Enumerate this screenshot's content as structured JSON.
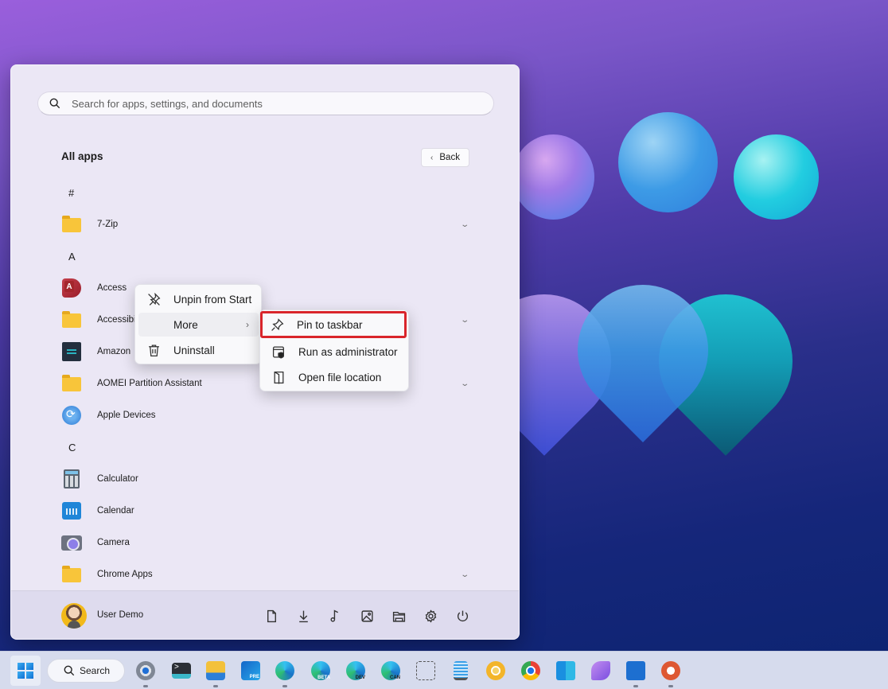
{
  "start_menu": {
    "search": {
      "placeholder": "Search for apps, settings, and documents"
    },
    "title": "All apps",
    "back_label": "Back",
    "sections": [
      {
        "letter": "#",
        "apps": [
          {
            "name": "7-Zip",
            "icon": "folder-icon",
            "expandable": true
          }
        ]
      },
      {
        "letter": "A",
        "apps": [
          {
            "name": "Access",
            "icon": "access-icon",
            "expandable": false
          },
          {
            "name": "Accessibility",
            "icon": "folder-icon",
            "expandable": true
          },
          {
            "name": "Amazon",
            "icon": "amazon-icon",
            "expandable": false
          },
          {
            "name": "AOMEI Partition Assistant",
            "icon": "folder-icon",
            "expandable": true
          },
          {
            "name": "Apple Devices",
            "icon": "apple-devices-icon",
            "expandable": false
          }
        ]
      },
      {
        "letter": "C",
        "apps": [
          {
            "name": "Calculator",
            "icon": "calculator-icon",
            "expandable": false
          },
          {
            "name": "Calendar",
            "icon": "calendar-icon",
            "expandable": false
          },
          {
            "name": "Camera",
            "icon": "camera-icon",
            "expandable": false
          },
          {
            "name": "Chrome Apps",
            "icon": "folder-icon",
            "expandable": true
          }
        ]
      }
    ],
    "visible_labels": {
      "accessibility_truncated": "Accessibi",
      "amazon": "Amazon"
    },
    "footer": {
      "user_name": "User Demo",
      "quick_icons": [
        "document-icon",
        "downloads-icon",
        "music-icon",
        "pictures-icon",
        "file-explorer-icon",
        "settings-icon",
        "power-icon"
      ]
    }
  },
  "context_menu": {
    "items": [
      {
        "label": "Unpin from Start",
        "icon": "unpin-icon"
      },
      {
        "label": "More",
        "icon": "",
        "has_submenu": true
      },
      {
        "label": "Uninstall",
        "icon": "trash-icon"
      }
    ]
  },
  "submenu": {
    "items": [
      {
        "label": "Pin to taskbar",
        "icon": "pin-icon",
        "highlighted": true
      },
      {
        "label": "Run as administrator",
        "icon": "admin-shield-icon"
      },
      {
        "label": "Open file location",
        "icon": "file-location-icon"
      }
    ],
    "highlight_color": "#d9252b"
  },
  "taskbar": {
    "search_label": "Search",
    "apps": [
      "settings",
      "terminal",
      "file-explorer",
      "outlook-preview",
      "edge",
      "edge-beta",
      "edge-dev",
      "edge-canary",
      "snipping-tool",
      "notepad",
      "chrome-canary",
      "chrome",
      "microsoft-365",
      "copilot-app",
      "microsoft-store",
      "duckduckgo"
    ],
    "badges": {
      "outlook": "PRE",
      "edge_beta": "BETA",
      "edge_dev": "DEV",
      "edge_canary": "CAN"
    }
  }
}
